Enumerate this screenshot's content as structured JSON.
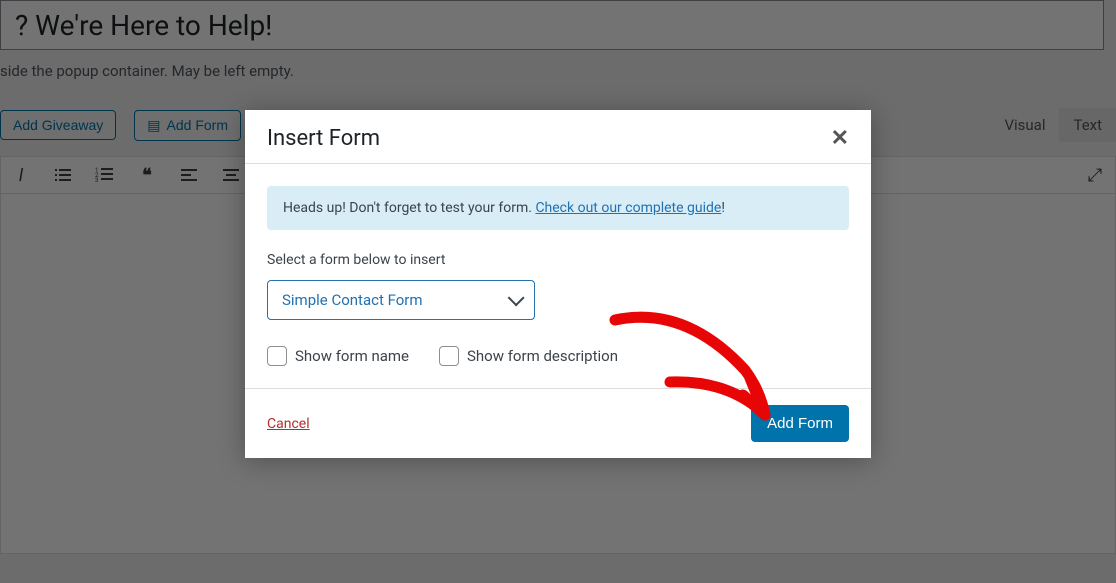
{
  "background": {
    "title": "? We're Here to Help!",
    "hint": "side the popup container. May be left empty.",
    "buttons": {
      "add_giveaway": "Add Giveaway",
      "add_form": "Add Form"
    },
    "tabs": {
      "visual": "Visual",
      "text": "Text"
    }
  },
  "modal": {
    "title": "Insert Form",
    "close": "✕",
    "notice_prefix": "Heads up! Don't forget to test your form. ",
    "notice_link": "Check out our complete guide",
    "notice_suffix": "!",
    "select_label": "Select a form below to insert",
    "selected_form": "Simple Contact Form",
    "checkbox_name": "Show form name",
    "checkbox_desc": "Show form description",
    "cancel": "Cancel",
    "add_form": "Add Form"
  }
}
